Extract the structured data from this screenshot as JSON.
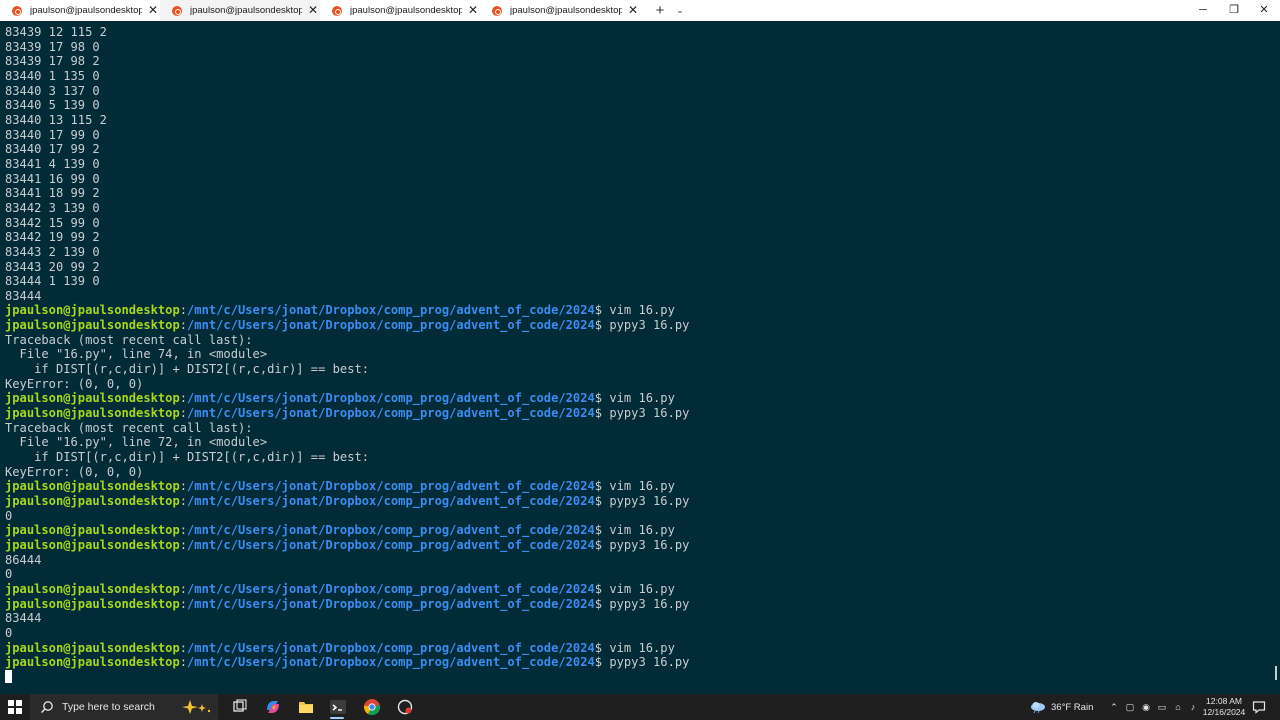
{
  "tabs": [
    {
      "title": "jpaulson@jpaulsondesktop: /m",
      "active": false
    },
    {
      "title": "jpaulson@jpaulsondesktop: /n",
      "active": true
    },
    {
      "title": "jpaulson@jpaulsondesktop: /m",
      "active": false
    },
    {
      "title": "jpaulson@jpaulsondesktop: /m",
      "active": false
    }
  ],
  "tab_controls": {
    "close": "✕",
    "new_tab": "+",
    "dropdown": "⌄"
  },
  "window_controls": {
    "minimize": "─",
    "maximize": "❐",
    "close": "✕"
  },
  "prompt": {
    "user_host": "jpaulson@jpaulsondesktop",
    "path": "/mnt/c/Users/jonat/Dropbox/comp_prog/advent_of_code/2024",
    "dollar": "$"
  },
  "terminal_lines": [
    {
      "type": "out",
      "text": "83439 12 115 2"
    },
    {
      "type": "out",
      "text": "83439 17 98 0"
    },
    {
      "type": "out",
      "text": "83439 17 98 2"
    },
    {
      "type": "out",
      "text": "83440 1 135 0"
    },
    {
      "type": "out",
      "text": "83440 3 137 0"
    },
    {
      "type": "out",
      "text": "83440 5 139 0"
    },
    {
      "type": "out",
      "text": "83440 13 115 2"
    },
    {
      "type": "out",
      "text": "83440 17 99 0"
    },
    {
      "type": "out",
      "text": "83440 17 99 2"
    },
    {
      "type": "out",
      "text": "83441 4 139 0"
    },
    {
      "type": "out",
      "text": "83441 16 99 0"
    },
    {
      "type": "out",
      "text": "83441 18 99 2"
    },
    {
      "type": "out",
      "text": "83442 3 139 0"
    },
    {
      "type": "out",
      "text": "83442 15 99 0"
    },
    {
      "type": "out",
      "text": "83442 19 99 2"
    },
    {
      "type": "out",
      "text": "83443 2 139 0"
    },
    {
      "type": "out",
      "text": "83443 20 99 2"
    },
    {
      "type": "out",
      "text": "83444 1 139 0"
    },
    {
      "type": "out",
      "text": "83444"
    },
    {
      "type": "cmd",
      "text": " vim 16.py"
    },
    {
      "type": "cmd",
      "text": " pypy3 16.py"
    },
    {
      "type": "out",
      "text": "Traceback (most recent call last):"
    },
    {
      "type": "out",
      "text": "  File \"16.py\", line 74, in <module>"
    },
    {
      "type": "out",
      "text": "    if DIST[(r,c,dir)] + DIST2[(r,c,dir)] == best:"
    },
    {
      "type": "out",
      "text": "KeyError: (0, 0, 0)"
    },
    {
      "type": "cmd",
      "text": " vim 16.py"
    },
    {
      "type": "cmd",
      "text": " pypy3 16.py"
    },
    {
      "type": "out",
      "text": "Traceback (most recent call last):"
    },
    {
      "type": "out",
      "text": "  File \"16.py\", line 72, in <module>"
    },
    {
      "type": "out",
      "text": "    if DIST[(r,c,dir)] + DIST2[(r,c,dir)] == best:"
    },
    {
      "type": "out",
      "text": "KeyError: (0, 0, 0)"
    },
    {
      "type": "cmd",
      "text": " vim 16.py"
    },
    {
      "type": "cmd",
      "text": " pypy3 16.py"
    },
    {
      "type": "out",
      "text": "0"
    },
    {
      "type": "cmd",
      "text": " vim 16.py"
    },
    {
      "type": "cmd",
      "text": " pypy3 16.py"
    },
    {
      "type": "out",
      "text": "86444"
    },
    {
      "type": "out",
      "text": "0"
    },
    {
      "type": "cmd",
      "text": " vim 16.py"
    },
    {
      "type": "cmd",
      "text": " pypy3 16.py"
    },
    {
      "type": "out",
      "text": "83444"
    },
    {
      "type": "out",
      "text": "0"
    },
    {
      "type": "cmd",
      "text": " vim 16.py"
    },
    {
      "type": "cmd",
      "text": " pypy3 16.py"
    },
    {
      "type": "cursor",
      "text": ""
    }
  ],
  "taskbar": {
    "search_placeholder": "Type here to search",
    "apps": [
      "task-view-icon",
      "copilot-icon",
      "file-explorer-icon",
      "terminal-icon",
      "chrome-icon",
      "app-icon"
    ],
    "weather": "36°F  Rain",
    "time": "12:08 AM",
    "date": "12/16/2024"
  },
  "colors": {
    "terminal_bg": "#012b36",
    "terminal_fg": "#c8cdd1",
    "prompt_user": "#a7d71c",
    "prompt_path": "#3a8cf0",
    "ubuntu_orange": "#e95420"
  }
}
